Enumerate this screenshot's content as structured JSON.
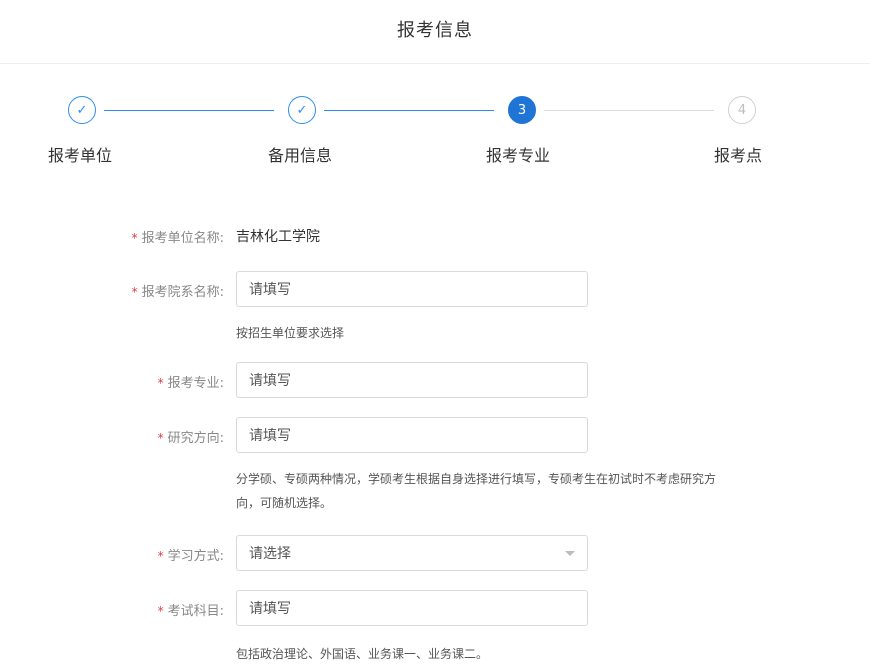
{
  "header": {
    "title": "报考信息"
  },
  "steps": [
    {
      "label": "报考单位",
      "marker": "✓",
      "state": "done"
    },
    {
      "label": "备用信息",
      "marker": "✓",
      "state": "done"
    },
    {
      "label": "报考专业",
      "marker": "3",
      "state": "active"
    },
    {
      "label": "报考点",
      "marker": "4",
      "state": "todo"
    }
  ],
  "colors": {
    "accent": "#1f74d6",
    "required": "#e23b3b"
  },
  "form": {
    "unit": {
      "label": "报考单位名称:",
      "value": "吉林化工学院"
    },
    "dept": {
      "label": "报考院系名称:",
      "placeholder": "请填写",
      "hint": "按招生单位要求选择"
    },
    "major": {
      "label": "报考专业:",
      "placeholder": "请填写"
    },
    "direction": {
      "label": "研究方向:",
      "placeholder": "请填写",
      "hint_line1": "分学硕、专硕两种情况，学硕考生根据自身选择进行填写，专硕考生在初试时不考虑研究方",
      "hint_line2": "向，可随机选择。"
    },
    "study_mode": {
      "label": "学习方式:",
      "placeholder": "请选择"
    },
    "subjects": {
      "label": "考试科目:",
      "placeholder": "请填写",
      "hint": "包括政治理论、外国语、业务课一、业务课二。"
    }
  }
}
